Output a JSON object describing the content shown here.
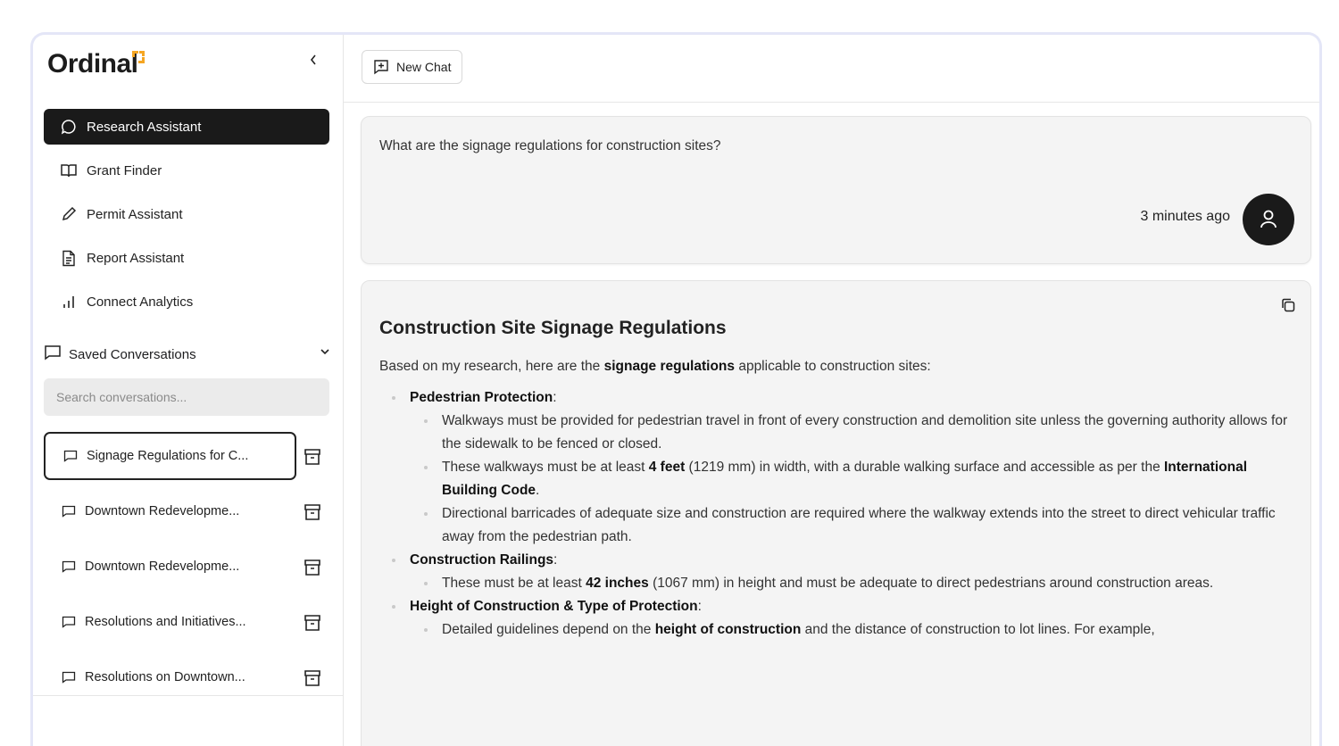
{
  "sidebar": {
    "logo": "Ordinal",
    "nav": [
      {
        "label": "Research Assistant",
        "icon": "chat-bubble-icon",
        "active": true
      },
      {
        "label": "Grant Finder",
        "icon": "book-icon"
      },
      {
        "label": "Permit Assistant",
        "icon": "pencil-icon"
      },
      {
        "label": "Report Assistant",
        "icon": "document-icon"
      },
      {
        "label": "Connect Analytics",
        "icon": "bar-chart-icon"
      }
    ],
    "saved_label": "Saved Conversations",
    "search_placeholder": "Search conversations...",
    "conversations": [
      {
        "label": "Signage Regulations for C..."
      },
      {
        "label": "Downtown Redevelopme..."
      },
      {
        "label": "Downtown Redevelopme..."
      },
      {
        "label": "Resolutions and Initiatives..."
      },
      {
        "label": "Resolutions on Downtown..."
      }
    ]
  },
  "toolbar": {
    "new_chat": "New Chat"
  },
  "question": {
    "text": "What are the signage regulations for construction sites?",
    "time": "3 minutes ago"
  },
  "answer": {
    "heading": "Construction Site Signage Regulations",
    "intro_pre": "Based on my research, here are the ",
    "intro_bold": "signage regulations",
    "intro_post": " applicable to construction sites:",
    "sections": [
      {
        "title": "Pedestrian Protection",
        "items": [
          {
            "pre": "Walkways must be provided for pedestrian travel in front of every construction and demolition site unless the governing authority allows for the sidewalk to be fenced or closed."
          },
          {
            "pre": "These walkways must be at least ",
            "b1": "4 feet",
            "mid": " (1219 mm) in width, with a durable walking surface and accessible as per the ",
            "b2": "International Building Code",
            "post": "."
          },
          {
            "pre": "Directional barricades of adequate size and construction are required where the walkway extends into the street to direct vehicular traffic away from the pedestrian path."
          }
        ]
      },
      {
        "title": "Construction Railings",
        "items": [
          {
            "pre": "These must be at least ",
            "b1": "42 inches",
            "mid": " (1067 mm) in height and must be adequate to direct pedestrians around construction areas."
          }
        ]
      },
      {
        "title": "Height of Construction & Type of Protection",
        "items": [
          {
            "pre": "Detailed guidelines depend on the ",
            "b1": "height of construction",
            "mid": " and the distance of construction to lot lines. For example,"
          }
        ]
      }
    ]
  }
}
